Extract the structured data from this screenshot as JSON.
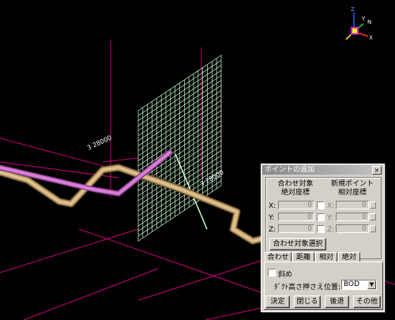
{
  "viewport": {
    "axis_gizmo": {
      "z_label": "Z",
      "y_label": "Y",
      "n_label": "N",
      "x_label": "X"
    },
    "grid_label": "3 28000",
    "coordinate_label": "3 28000"
  },
  "dialog": {
    "title": "ポイントの追加",
    "close_label": "×",
    "header_left_line1": "合わせ対象",
    "header_left_line2": "絶対座標",
    "header_right_line1": "新規ポイント",
    "header_right_line2": "相対座標",
    "rows": [
      {
        "label": "X:",
        "left_value": "0",
        "right_label": "X:",
        "right_value": "0"
      },
      {
        "label": "Y:",
        "left_value": "0",
        "right_label": "Y:",
        "right_value": "0"
      },
      {
        "label": "Z:",
        "left_value": "0",
        "right_label": "Z:",
        "right_value": "0"
      }
    ],
    "select_target_button": "合わせ対象選択",
    "tabs": [
      "合わせ",
      "距離",
      "相対",
      "絶対"
    ],
    "diagonal_label": "斜め",
    "duct_label": "ﾀﾞｸﾄ高さ押さえ位置:",
    "duct_value": "BOD",
    "buttons": {
      "ok": "決定",
      "close": "閉じる",
      "back": "後退",
      "other": "その他"
    }
  }
}
